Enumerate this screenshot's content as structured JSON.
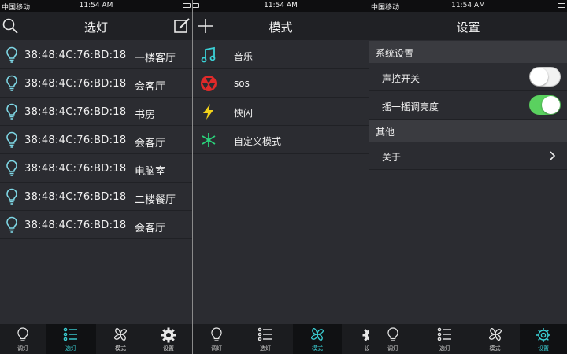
{
  "status_bar": {
    "carrier": "中国移动",
    "time": "11:54 AM"
  },
  "colors": {
    "accent": "#3bd1d6",
    "bulb": "#7fd8e6",
    "toggle_on": "#5ad15f",
    "sos": "#e02a2a",
    "flash": "#f2d21a",
    "custom": "#2ad17a"
  },
  "select_screen": {
    "title": "选灯",
    "lights": [
      {
        "mac": "38:48:4C:76:BD:18",
        "room": "一楼客厅"
      },
      {
        "mac": "38:48:4C:76:BD:18",
        "room": "会客厅"
      },
      {
        "mac": "38:48:4C:76:BD:18",
        "room": "书房"
      },
      {
        "mac": "38:48:4C:76:BD:18",
        "room": "会客厅"
      },
      {
        "mac": "38:48:4C:76:BD:18",
        "room": "电脑室"
      },
      {
        "mac": "38:48:4C:76:BD:18",
        "room": "二楼餐厅"
      },
      {
        "mac": "38:48:4C:76:BD:18",
        "room": "会客厅"
      }
    ]
  },
  "mode_screen": {
    "title": "模式",
    "modes": [
      {
        "label": "音乐",
        "icon": "music-note-icon"
      },
      {
        "label": "sos",
        "icon": "sos-icon"
      },
      {
        "label": "快闪",
        "icon": "lightning-icon"
      },
      {
        "label": "自定义模式",
        "icon": "custom-mode-icon"
      }
    ]
  },
  "settings_screen": {
    "title": "设置",
    "section_system": "系统设置",
    "voice_control": {
      "label": "声控开关",
      "on": false
    },
    "shake_brightness": {
      "label": "摇一摇调亮度",
      "on": true
    },
    "section_other": "其他",
    "about": "关于"
  },
  "tabs": [
    {
      "label": "调灯",
      "icon": "bulb-icon"
    },
    {
      "label": "选灯",
      "icon": "list-icon"
    },
    {
      "label": "模式",
      "icon": "fan-icon"
    },
    {
      "label": "设置",
      "icon": "gear-icon"
    }
  ]
}
